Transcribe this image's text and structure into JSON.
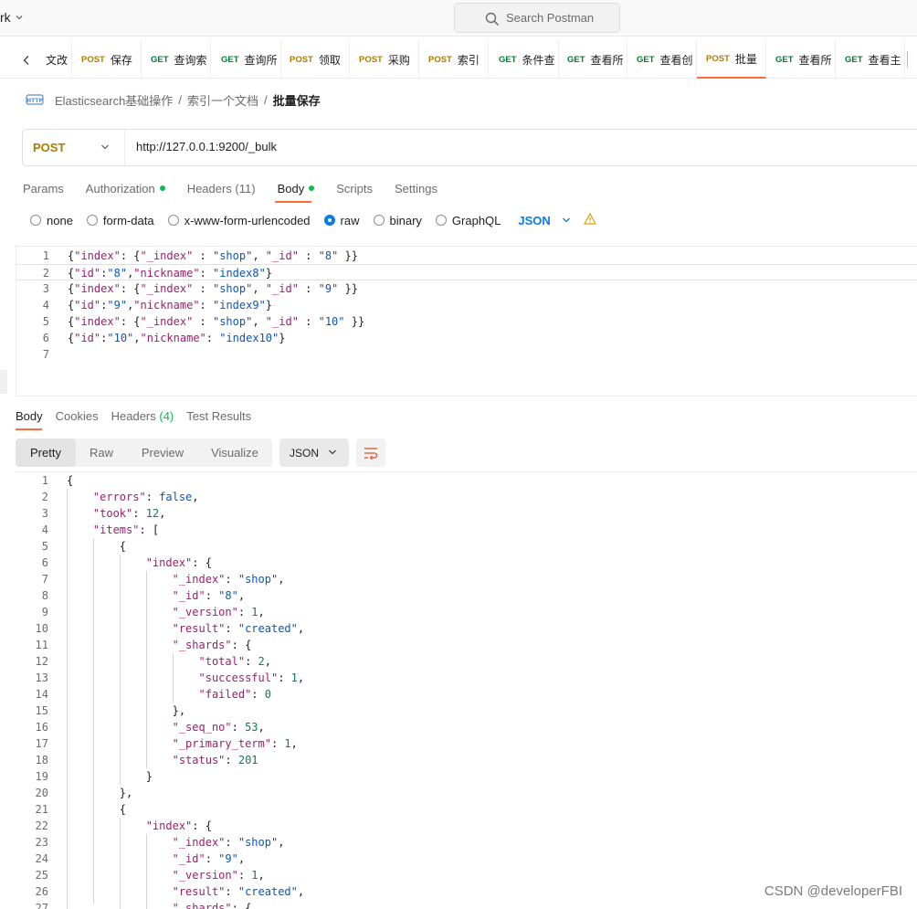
{
  "topbar": {
    "workspace_label": "rk",
    "search_placeholder": "Search Postman"
  },
  "tabs": [
    {
      "method": "",
      "label": "文改"
    },
    {
      "method": "POST",
      "label": "保存"
    },
    {
      "method": "GET",
      "label": "查询索"
    },
    {
      "method": "GET",
      "label": "查询所"
    },
    {
      "method": "POST",
      "label": "领取"
    },
    {
      "method": "POST",
      "label": "采购"
    },
    {
      "method": "POST",
      "label": "索引"
    },
    {
      "method": "GET",
      "label": "条件查"
    },
    {
      "method": "GET",
      "label": "查看所"
    },
    {
      "method": "GET",
      "label": "查看创"
    },
    {
      "method": "POST",
      "label": "批量"
    },
    {
      "method": "GET",
      "label": "查看所"
    },
    {
      "method": "GET",
      "label": "查看主"
    }
  ],
  "breadcrumb": {
    "icon": "http-icon",
    "items": [
      "Elasticsearch基础操作",
      "索引一个文档",
      "批量保存"
    ],
    "separator": "/"
  },
  "request": {
    "method": "POST",
    "url": "http://127.0.0.1:9200/_bulk",
    "tabs": [
      {
        "label": "Params",
        "dot": false
      },
      {
        "label": "Authorization",
        "dot": true
      },
      {
        "label": "Headers (11)",
        "dot": false
      },
      {
        "label": "Body",
        "dot": true
      },
      {
        "label": "Scripts",
        "dot": false
      },
      {
        "label": "Settings",
        "dot": false
      }
    ],
    "body_types": [
      "none",
      "form-data",
      "x-www-form-urlencoded",
      "raw",
      "binary",
      "GraphQL"
    ],
    "selected_body_type": "raw",
    "language": "JSON",
    "body_lines": [
      "{\"index\": {\"_index\" : \"shop\", \"_id\" : \"8\" }} ",
      "{\"id\":\"8\",\"nickname\": \"index8\"} ",
      "{\"index\": {\"_index\" : \"shop\", \"_id\" : \"9\" }} ",
      "{\"id\":\"9\",\"nickname\": \"index9\"} ",
      "{\"index\": {\"_index\" : \"shop\", \"_id\" : \"10\" }} ",
      "{\"id\":\"10\",\"nickname\": \"index10\"} ",
      ""
    ]
  },
  "response": {
    "tabs": [
      "Body",
      "Cookies",
      "Headers",
      "Test Results"
    ],
    "headers_count": "(4)",
    "views": [
      "Pretty",
      "Raw",
      "Preview",
      "Visualize"
    ],
    "active_view": "Pretty",
    "format": "JSON",
    "lines": [
      "{",
      "    \"errors\": false,",
      "    \"took\": 12,",
      "    \"items\": [",
      "        {",
      "            \"index\": {",
      "                \"_index\": \"shop\",",
      "                \"_id\": \"8\",",
      "                \"_version\": 1,",
      "                \"result\": \"created\",",
      "                \"_shards\": {",
      "                    \"total\": 2,",
      "                    \"successful\": 1,",
      "                    \"failed\": 0",
      "                },",
      "                \"_seq_no\": 53,",
      "                \"_primary_term\": 1,",
      "                \"status\": 201",
      "            }",
      "        },",
      "        {",
      "            \"index\": {",
      "                \"_index\": \"shop\",",
      "                \"_id\": \"9\",",
      "                \"_version\": 1,",
      "                \"result\": \"created\",",
      "                \"_shards\": {"
    ]
  },
  "watermark": "CSDN @developerFBI"
}
